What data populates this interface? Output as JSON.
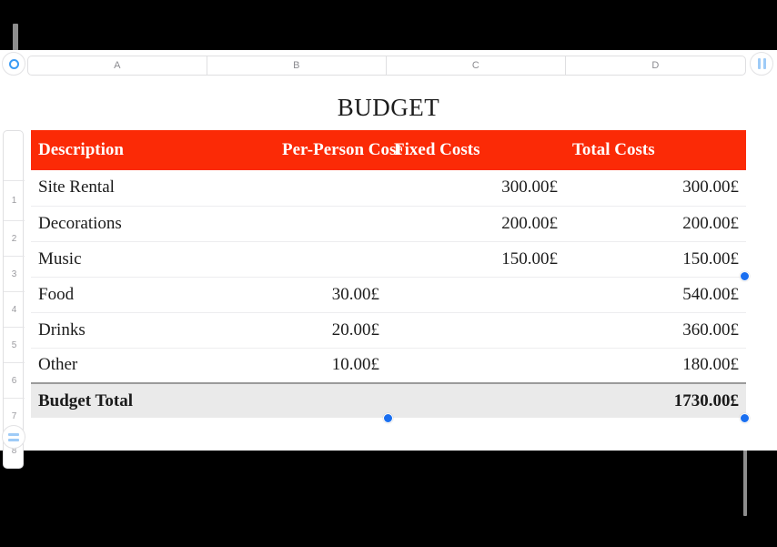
{
  "app": {
    "title": "BUDGET",
    "accent_red": "#fb2a06",
    "handle_blue": "#1a6ff0",
    "icon_blue": "#3a9bf5"
  },
  "column_headers": {
    "labels": [
      "A",
      "B",
      "C",
      "D"
    ]
  },
  "row_headers": {
    "labels": [
      "1",
      "2",
      "3",
      "4",
      "5",
      "6",
      "7",
      "8"
    ]
  },
  "corner_controls": {
    "select_all_label": "",
    "column_grip_label": "",
    "row_grip_label": ""
  },
  "table": {
    "header": {
      "description": "Description",
      "per_person_cost": "Per-Person Cost",
      "fixed_costs": "Fixed Costs",
      "total_costs": "Total Costs"
    },
    "rows": [
      {
        "description": "Site Rental",
        "per_person": "",
        "fixed": "300.00£",
        "total": "300.00£"
      },
      {
        "description": "Decorations",
        "per_person": "",
        "fixed": "200.00£",
        "total": "200.00£"
      },
      {
        "description": "Music",
        "per_person": "",
        "fixed": "150.00£",
        "total": "150.00£"
      },
      {
        "description": "Food",
        "per_person": "30.00£",
        "fixed": "",
        "total": "540.00£"
      },
      {
        "description": "Drinks",
        "per_person": "20.00£",
        "fixed": "",
        "total": "360.00£"
      },
      {
        "description": "Other",
        "per_person": "10.00£",
        "fixed": "",
        "total": "180.00£"
      }
    ],
    "footer": {
      "label": "Budget Total",
      "blank_b": "",
      "blank_c": "",
      "total": "1730.00£"
    }
  }
}
